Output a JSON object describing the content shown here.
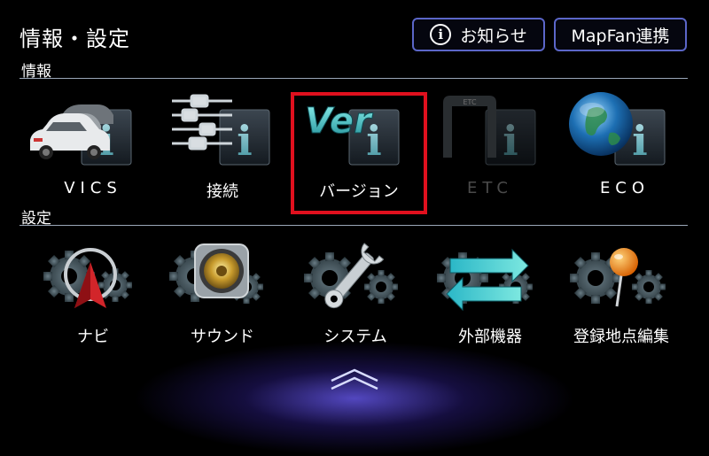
{
  "header": {
    "title": "情報・設定",
    "news_button": "お知らせ",
    "mapfan_button": "MapFan連携"
  },
  "sections": {
    "info": "情報",
    "settings": "設定"
  },
  "info_tiles": [
    {
      "label": "VICS",
      "icon": "cars-info-icon",
      "enabled": true
    },
    {
      "label": "接続",
      "icon": "connector-info-icon",
      "enabled": true
    },
    {
      "label": "バージョン",
      "icon": "version-info-icon",
      "enabled": true,
      "selected": true,
      "badge": "Ver"
    },
    {
      "label": "ETC",
      "icon": "etc-gate-info-icon",
      "enabled": false,
      "badge": "ETC"
    },
    {
      "label": "ECO",
      "icon": "globe-info-icon",
      "enabled": true
    }
  ],
  "settings_tiles": [
    {
      "label": "ナビ",
      "icon": "navi-gear-icon"
    },
    {
      "label": "サウンド",
      "icon": "speaker-gear-icon"
    },
    {
      "label": "システム",
      "icon": "wrench-gear-icon"
    },
    {
      "label": "外部機器",
      "icon": "arrows-gear-icon"
    },
    {
      "label": "登録地点編集",
      "icon": "pin-gear-icon"
    }
  ],
  "colors": {
    "selection": "#e0101e",
    "button_border": "#5b66c8",
    "disabled_text": "#4a4a4a"
  }
}
